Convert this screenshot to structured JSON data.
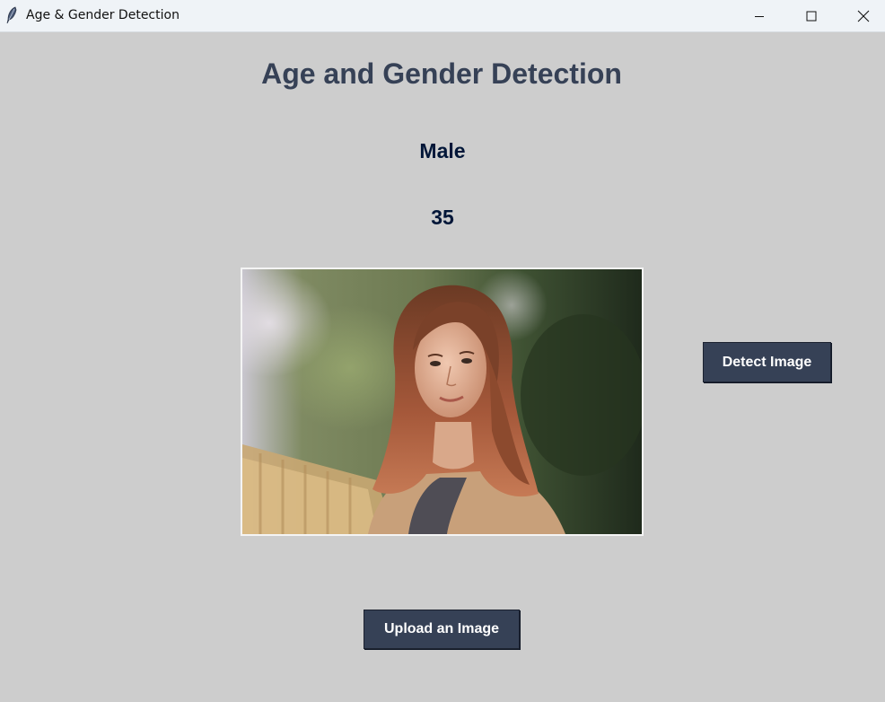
{
  "window": {
    "title": "Age & Gender Detection",
    "icons": [
      "feather-icon",
      "minimize-icon",
      "maximize-icon",
      "close-icon"
    ]
  },
  "main": {
    "heading": "Age and Gender Detection",
    "gender": "Male",
    "age": "35",
    "image_description_hidden": null
  },
  "buttons": {
    "detect_label": "Detect Image",
    "upload_label": "Upload an Image"
  },
  "colors": {
    "background": "#cdcdcd",
    "heading": "#364156",
    "result_text": "#011638",
    "button_bg": "#364156",
    "button_text": "#ffffff"
  }
}
